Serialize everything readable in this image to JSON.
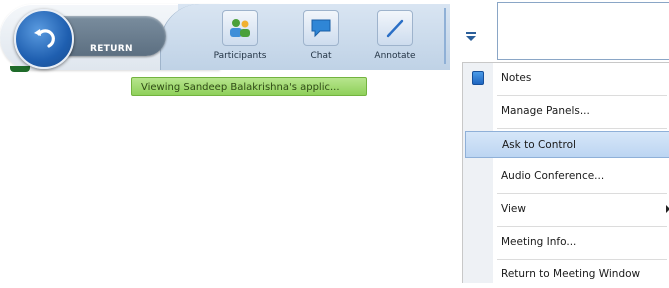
{
  "toolbar": {
    "return_label": "RETURN",
    "tools": [
      {
        "label": "Participants",
        "icon": "participants-icon"
      },
      {
        "label": "Chat",
        "icon": "chat-icon"
      },
      {
        "label": "Annotate",
        "icon": "annotate-icon"
      }
    ],
    "menu_icon": "dropdown-menu-icon"
  },
  "status": {
    "text": "Viewing Sandeep Balakrishna's applic..."
  },
  "menu": {
    "items": [
      {
        "label": "Notes",
        "icon": "notes-icon"
      },
      {
        "label": "Manage Panels..."
      },
      {
        "label": "Ask to Control",
        "highlighted": true
      },
      {
        "label": "Audio Conference..."
      },
      {
        "label": "View",
        "submenu": true
      },
      {
        "label": "Meeting Info..."
      },
      {
        "label": "Return to Meeting Window"
      }
    ]
  },
  "colors": {
    "accent_blue": "#1f5fb0",
    "status_green": "#8fd05a",
    "highlight": "#bcd5f2"
  }
}
